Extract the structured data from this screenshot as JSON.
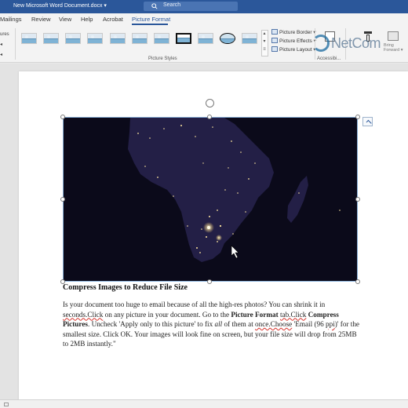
{
  "window": {
    "doc_title": "New Microsoft Word Document.docx ▾"
  },
  "search": {
    "placeholder": "Search"
  },
  "ribbon": {
    "tabs": [
      "Mailings",
      "Review",
      "View",
      "Help",
      "Acrobat",
      "Picture Format"
    ],
    "active_tab": "Picture Format",
    "left_fragment": [
      "ures",
      "◂",
      "◂"
    ],
    "picture_styles_label": "Picture Styles",
    "picture_border": "Picture Border ▾",
    "picture_effects": "Picture Effects ▾",
    "picture_layout": "Picture Layout ▾",
    "accessibility_label": "Accessibi...",
    "bring_forward": "Bring Forward ▾"
  },
  "watermark": {
    "text": "NetCom"
  },
  "document": {
    "heading": "Compress Images to Reduce File Size",
    "body": {
      "s1": "Is your document too huge to email because of all the high-res photos? You can shrink it in ",
      "w1": "seconds.Click",
      "s2": " on any picture in your document. Go to the ",
      "b1": "Picture Format",
      "w2": "tab.Click",
      "b2": "Compress Pictures",
      "s3": ". Uncheck 'Apply only to this picture' to fix ",
      "i1": "all",
      "s4": " of them at ",
      "w3": "once.Choose",
      "s5": " 'Email (96 ",
      "w4": "ppi",
      "s6": ")' for the smallest size. Click OK. Your images will look fine on screen, but your file size will drop from 25MB to 2MB instantly.\""
    }
  },
  "colors": {
    "accent": "#2b579a",
    "spell_error": "#d6332c",
    "image_bg": "#0b0a1a"
  }
}
